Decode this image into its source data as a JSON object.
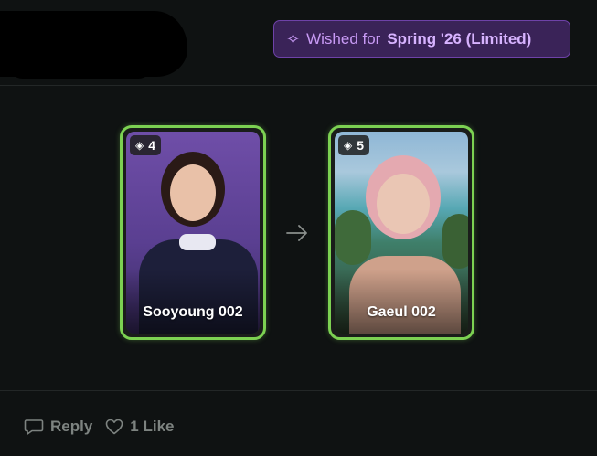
{
  "header": {
    "wish_prefix": "Wished for",
    "wish_season": "Spring '26 (Limited)"
  },
  "trade": {
    "from_card": {
      "name": "Sooyoung 002",
      "level": "4"
    },
    "to_card": {
      "name": "Gaeul 002",
      "level": "5"
    }
  },
  "footer": {
    "reply_label": "Reply",
    "like_label": "1 Like"
  },
  "colors": {
    "background": "#0f1212",
    "card_border": "#7cd152",
    "badge_bg": "#3a2358",
    "badge_text": "#c89af5",
    "muted_text": "#7d8380"
  },
  "icons": [
    "sparkle-icon",
    "gem-icon",
    "arrow-right-icon",
    "reply-icon",
    "heart-icon"
  ]
}
